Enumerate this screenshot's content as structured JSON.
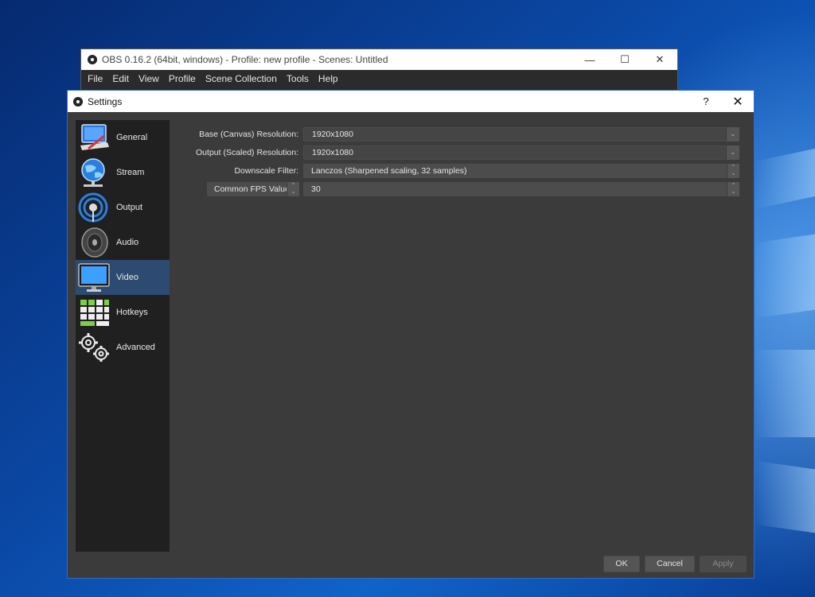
{
  "obs_window": {
    "title": "OBS 0.16.2 (64bit, windows) - Profile: new profile - Scenes: Untitled",
    "minimize": "—",
    "maximize": "☐",
    "close": "✕",
    "menu": [
      "File",
      "Edit",
      "View",
      "Profile",
      "Scene Collection",
      "Tools",
      "Help"
    ]
  },
  "settings": {
    "title": "Settings",
    "help": "?",
    "close": "✕",
    "sidebar": [
      {
        "label": "General",
        "icon": "general-icon"
      },
      {
        "label": "Stream",
        "icon": "stream-icon"
      },
      {
        "label": "Output",
        "icon": "output-icon"
      },
      {
        "label": "Audio",
        "icon": "audio-icon"
      },
      {
        "label": "Video",
        "icon": "video-icon",
        "active": true
      },
      {
        "label": "Hotkeys",
        "icon": "hotkeys-icon"
      },
      {
        "label": "Advanced",
        "icon": "advanced-icon"
      }
    ],
    "video": {
      "base_label": "Base (Canvas) Resolution:",
      "base_value": "1920x1080",
      "output_label": "Output (Scaled) Resolution:",
      "output_value": "1920x1080",
      "downscale_label": "Downscale Filter:",
      "downscale_value": "Lanczos (Sharpened scaling, 32 samples)",
      "fps_type": "Common FPS Values",
      "fps_value": "30"
    },
    "buttons": {
      "ok": "OK",
      "cancel": "Cancel",
      "apply": "Apply"
    }
  },
  "colors": {
    "dialog_bg": "#3b3b3b",
    "sidebar_bg": "#202020",
    "active_item": "#2d4b70",
    "accent_border": "#2f6ac7"
  }
}
